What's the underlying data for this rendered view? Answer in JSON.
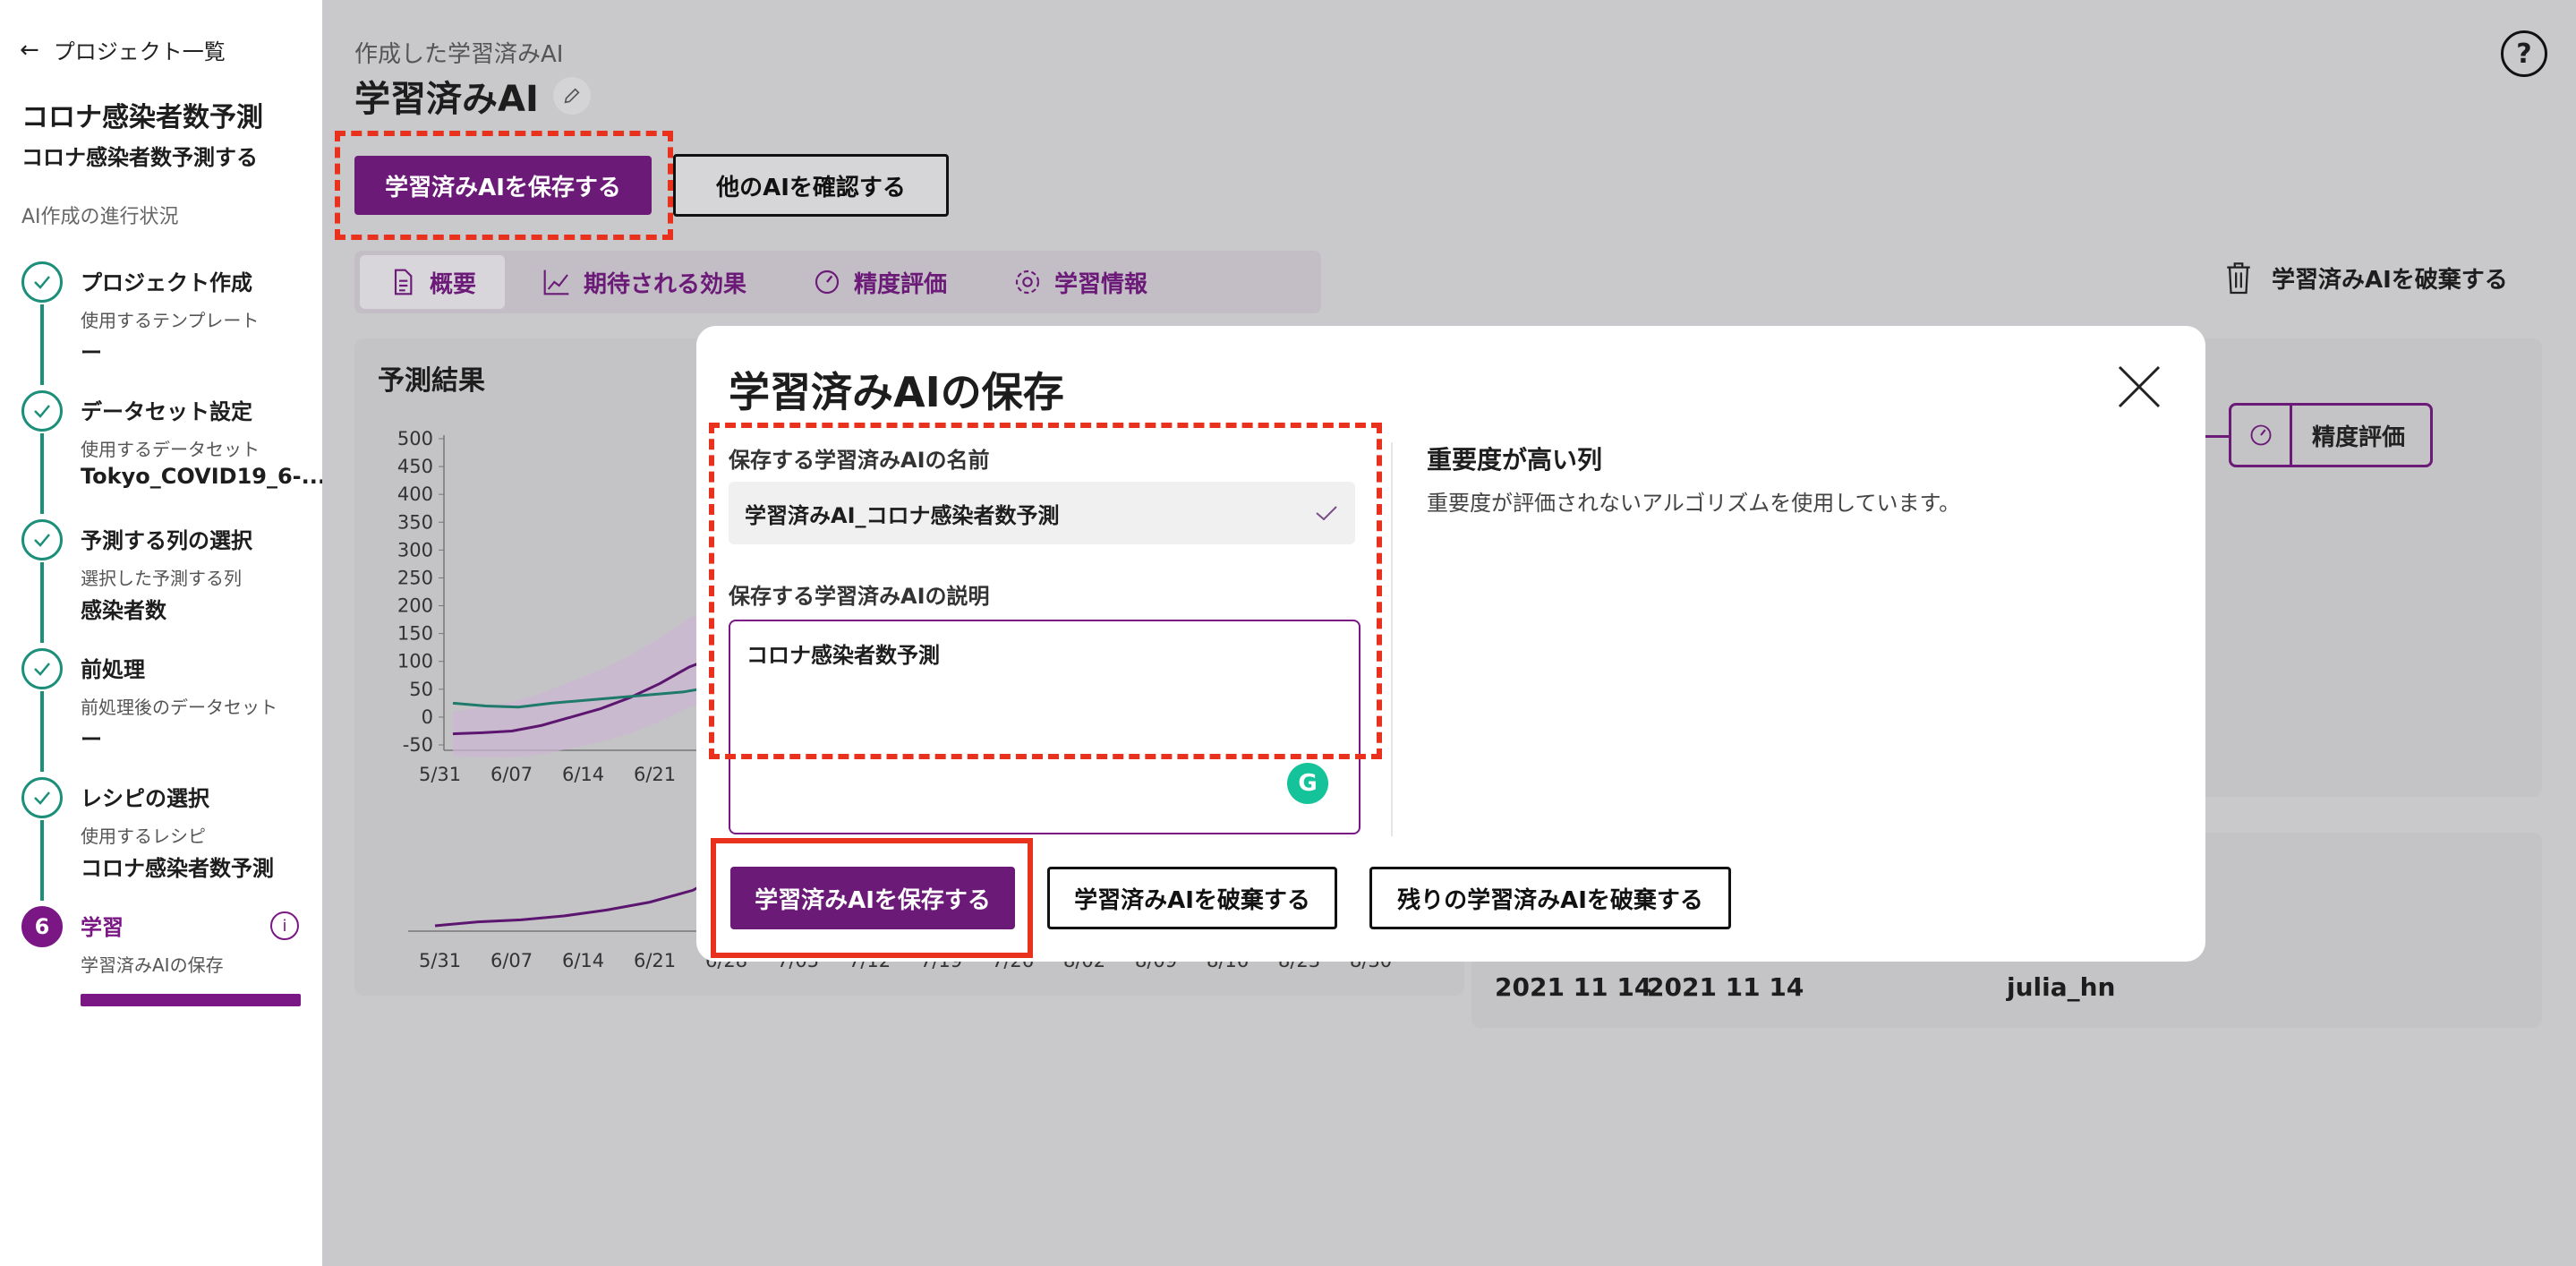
{
  "sidebar": {
    "back_label": "プロジェクト一覧",
    "project_title": "コロナ感染者数予測",
    "project_subtitle": "コロナ感染者数予測する",
    "progress_label": "AI作成の進行状況",
    "steps": [
      {
        "title": "プロジェクト作成",
        "label": "使用するテンプレート",
        "value": "ー"
      },
      {
        "title": "データセット設定",
        "label": "使用するデータセット",
        "value": "Tokyo_COVID19_6-..."
      },
      {
        "title": "予測する列の選択",
        "label": "選択した予測する列",
        "value": "感染者数"
      },
      {
        "title": "前処理",
        "label": "前処理後のデータセット",
        "value": "ー"
      },
      {
        "title": "レシピの選択",
        "label": "使用するレシピ",
        "value": "コロナ感染者数予測"
      },
      {
        "number": "6",
        "title": "学習",
        "label": "学習済みAIの保存",
        "info": "i"
      }
    ]
  },
  "header": {
    "breadcrumb": "作成した学習済みAI",
    "title": "学習済みAI",
    "help": "?"
  },
  "toolbar": {
    "save_label": "学習済みAIを保存する",
    "other_label": "他のAIを確認する",
    "discard_label": "学習済みAIを破棄する"
  },
  "tabs": [
    {
      "label": "概要",
      "icon": "document-icon"
    },
    {
      "label": "期待される効果",
      "icon": "chart-line-icon"
    },
    {
      "label": "精度評価",
      "icon": "gauge-icon"
    },
    {
      "label": "学習情報",
      "icon": "gear-icon"
    }
  ],
  "card_left": {
    "title": "予測結果"
  },
  "card_right": {
    "eval_label": "精度評価"
  },
  "meta": {
    "date1": "2021 11 14",
    "date2": "2021 11 14",
    "user": "julia_hn"
  },
  "chart_data": [
    {
      "type": "line",
      "title": "",
      "xlabel": "",
      "ylabel": "",
      "ylim": [
        -50,
        500
      ],
      "yticks": [
        "500",
        "450",
        "400",
        "350",
        "300",
        "250",
        "200",
        "150",
        "100",
        "50",
        "0",
        "-50"
      ],
      "categories": [
        "5/31",
        "6/07",
        "6/14",
        "6/21"
      ],
      "series": [
        {
          "values": [
            -30,
            -28,
            -25,
            -15,
            0,
            15,
            35,
            60,
            90,
            110,
            130
          ]
        },
        {
          "values": [
            25,
            20,
            18,
            25,
            30,
            35,
            40,
            45,
            55,
            60
          ]
        }
      ],
      "grid": false
    },
    {
      "type": "line",
      "categories": [
        "5/31",
        "6/07",
        "6/14",
        "6/21",
        "6/28",
        "7/05",
        "7/12",
        "7/19",
        "7/26",
        "8/02",
        "8/09",
        "8/16",
        "8/23",
        "8/30"
      ],
      "series": [
        {
          "values": [
            0,
            2,
            3,
            5,
            8,
            12,
            18,
            30
          ]
        }
      ]
    }
  ],
  "modal": {
    "title": "学習済みAIの保存",
    "name_label": "保存する学習済みAIの名前",
    "name_value": "学習済みAI_コロナ感染者数予測",
    "desc_label": "保存する学習済みAIの説明",
    "desc_value": "コロナ感染者数予測",
    "important_title": "重要度が高い列",
    "important_text": "重要度が評価されないアルゴリズムを使用しています。",
    "save_label": "学習済みAIを保存する",
    "discard_label": "学習済みAIを破棄する",
    "discard_rest_label": "残りの学習済みAIを破棄する"
  }
}
